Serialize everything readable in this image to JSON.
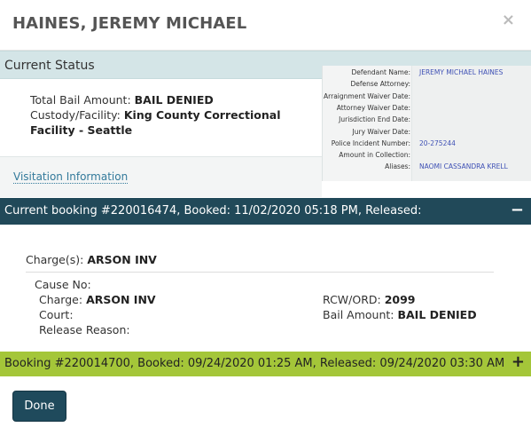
{
  "modal": {
    "title": "HAINES, JEREMY MICHAEL",
    "close_glyph": "×"
  },
  "status": {
    "heading": "Current Status",
    "bail_label": "Total Bail Amount:",
    "bail_value": "BAIL DENIED",
    "custody_label": "Custody/Facility:",
    "custody_value": "King County Correctional Facility - Seattle"
  },
  "details": [
    {
      "label": "Defendant Name:",
      "value": "JEREMY MICHAEL HAINES"
    },
    {
      "label": "Defense Attorney:",
      "value": ""
    },
    {
      "label": "Arraignment Waiver Date:",
      "value": ""
    },
    {
      "label": "Attorney Waiver Date:",
      "value": ""
    },
    {
      "label": "Jurisdiction End Date:",
      "value": ""
    },
    {
      "label": "Jury Waiver Date:",
      "value": ""
    },
    {
      "label": "Police Incident Number:",
      "value": "20-275244"
    },
    {
      "label": "Amount in Collection:",
      "value": ""
    },
    {
      "label": "Aliases:",
      "value": "NAOMI CASSANDRA KRELL"
    }
  ],
  "visitation": {
    "link_label": "Visitation Information"
  },
  "current_booking": {
    "title": "Current booking #220016474, Booked: 11/02/2020 05:18 PM, Released:",
    "toggle_glyph": "−",
    "charges_label": "Charge(s):",
    "charges_value": "ARSON INV",
    "cause_label": "Cause No:",
    "cause_value": "",
    "charge_label": "Charge:",
    "charge_value": "ARSON INV",
    "court_label": "Court:",
    "court_value": "",
    "release_label": "Release Reason:",
    "release_value": "",
    "rcw_label": "RCW/ORD:",
    "rcw_value": "2099",
    "bail_label": "Bail Amount:",
    "bail_value": "BAIL DENIED"
  },
  "previous_booking": {
    "title": "Booking #220014700, Booked: 09/24/2020 01:25 AM, Released: 09/24/2020 03:30 AM",
    "toggle_glyph": "+"
  },
  "footer": {
    "done_label": "Done"
  },
  "colors": {
    "status_bar": "#d4e5e7",
    "current_booking_bar": "#214959",
    "previous_booking_bar": "#a4c639",
    "done_button": "#1f4a5c",
    "link": "#337a9b"
  }
}
